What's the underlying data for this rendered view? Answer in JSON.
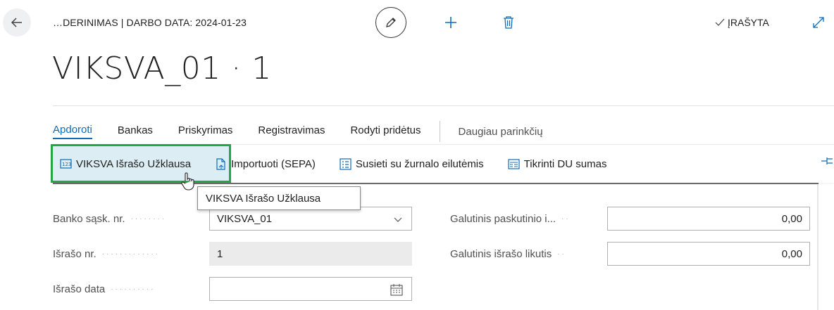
{
  "header": {
    "breadcrumb": "…DERINIMAS | DARBO DATA: 2024-01-23",
    "saved_status": "ĮRAŠYTA"
  },
  "page": {
    "title": "VIKSVA_01 · 1"
  },
  "action_tabs": [
    {
      "label": "Apdoroti",
      "active": true
    },
    {
      "label": "Bankas"
    },
    {
      "label": "Priskyrimas"
    },
    {
      "label": "Registravimas"
    },
    {
      "label": "Rodyti pridėtus"
    }
  ],
  "action_more": "Daugiau parinkčių",
  "toolbar": {
    "items": [
      {
        "label": "VIKSVA Išrašo Užklausa",
        "icon": "statement-request-icon"
      },
      {
        "label": "Importuoti (SEPA)",
        "icon": "import-file-icon"
      },
      {
        "label": "Susieti su žurnalo eilutėmis",
        "icon": "match-list-icon"
      },
      {
        "label": "Tikrinti DU sumas",
        "icon": "check-list-icon"
      }
    ]
  },
  "tooltip": "VIKSVA Išrašo Užklausa",
  "fields": {
    "bank_account": {
      "label": "Banko sąsk. nr.",
      "value": "VIKSVA_01"
    },
    "statement_no": {
      "label": "Išrašo nr.",
      "value": "1"
    },
    "statement_date": {
      "label": "Išrašo data",
      "value": ""
    },
    "last_ending_balance": {
      "label": "Galutinis paskutinio i...",
      "value": "0,00"
    },
    "ending_balance": {
      "label": "Galutinis išrašo likutis",
      "value": "0,00"
    }
  },
  "colors": {
    "accent": "#0f6cbd",
    "highlight_border": "#22a744",
    "highlight_fill": "#ddedf4"
  }
}
